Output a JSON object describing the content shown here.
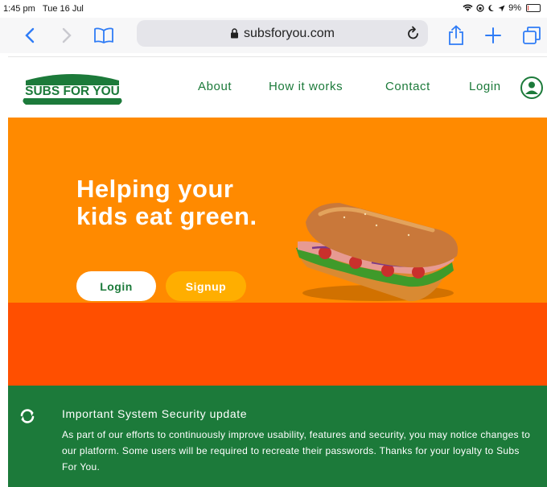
{
  "statusbar": {
    "time": "1:45 pm",
    "date": "Tue 16 Jul",
    "battery_text": "9%",
    "battery_level": 0.09
  },
  "browser": {
    "url": "subsforyou.com"
  },
  "site": {
    "logo_text": "SUBS FOR YOU",
    "nav": [
      {
        "label": "About"
      },
      {
        "label": "How it works"
      },
      {
        "label": "Contact"
      },
      {
        "label": "Login"
      }
    ]
  },
  "hero": {
    "title_line1": "Helping your",
    "title_line2": "kids eat green.",
    "login_label": "Login",
    "signup_label": "Signup"
  },
  "notice": {
    "title": "Important System Security update",
    "body": "As part of our efforts to continuously improve usability, features and security, you may notice changes to our platform. Some users will be required to recreate their passwords. Thanks for your loyalty to Subs For You."
  },
  "colors": {
    "brand_green": "#1c7a3a",
    "hero_orange": "#ff8a00",
    "band_orange": "#ff4f00",
    "signup_yellow": "#ffae00"
  }
}
